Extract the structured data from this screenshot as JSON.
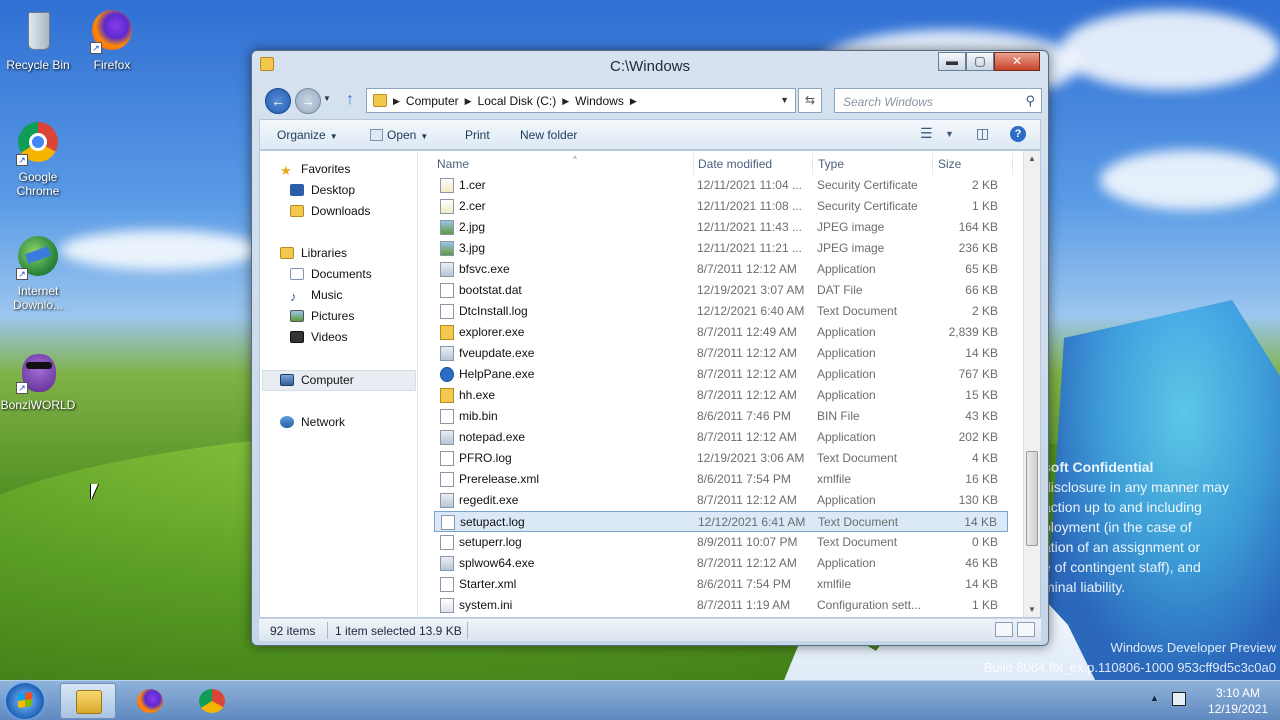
{
  "desktop": {
    "icons": [
      {
        "label": "Recycle Bin",
        "icon": "recycle-bin-icon"
      },
      {
        "label": "Firefox",
        "icon": "firefox-icon"
      },
      {
        "label": "Google Chrome",
        "icon": "chrome-icon"
      },
      {
        "label": "Internet Downlo...",
        "icon": "internet-download-manager-icon"
      },
      {
        "label": "BonziWORLD",
        "icon": "bonziworld-icon"
      }
    ],
    "watermark": {
      "title": "soft Confidential",
      "body": "disclosure in any manner may\naction up to and including\nployment (in the case of\nation of an assignment or\ne of contingent staff), and\nminal liability.",
      "build_line1": "Windows Developer Preview",
      "build_line2": "Build 8064.fbl_ex.p.110806-1000 953cff9d5c3c0a0"
    }
  },
  "window": {
    "title": "C:\\Windows",
    "controls": {
      "minimize": "▬",
      "maximize": "▢",
      "close": "✕"
    },
    "address": {
      "crumbs": [
        "Computer",
        "Local Disk (C:)",
        "Windows"
      ]
    },
    "search": {
      "placeholder": "Search Windows"
    },
    "toolbar": {
      "organize": "Organize",
      "open": "Open",
      "print": "Print",
      "new_folder": "New folder"
    },
    "nav": {
      "favorites": "Favorites",
      "desktop": "Desktop",
      "downloads": "Downloads",
      "libraries": "Libraries",
      "documents": "Documents",
      "music": "Music",
      "pictures": "Pictures",
      "videos": "Videos",
      "computer": "Computer",
      "network": "Network"
    },
    "columns": {
      "name": "Name",
      "date": "Date modified",
      "type": "Type",
      "size": "Size"
    },
    "files": [
      {
        "name": "1.cer",
        "date": "12/11/2021 11:04 ...",
        "type": "Security Certificate",
        "size": "2 KB",
        "icon": "cert"
      },
      {
        "name": "2.cer",
        "date": "12/11/2021 11:08 ...",
        "type": "Security Certificate",
        "size": "1 KB",
        "icon": "cert"
      },
      {
        "name": "2.jpg",
        "date": "12/11/2021 11:43 ...",
        "type": "JPEG image",
        "size": "164 KB",
        "icon": "img"
      },
      {
        "name": "3.jpg",
        "date": "12/11/2021 11:21 ...",
        "type": "JPEG image",
        "size": "236 KB",
        "icon": "img"
      },
      {
        "name": "bfsvc.exe",
        "date": "8/7/2011 12:12 AM",
        "type": "Application",
        "size": "65 KB",
        "icon": "app"
      },
      {
        "name": "bootstat.dat",
        "date": "12/19/2021 3:07 AM",
        "type": "DAT File",
        "size": "66 KB",
        "icon": "file"
      },
      {
        "name": "DtcInstall.log",
        "date": "12/12/2021 6:40 AM",
        "type": "Text Document",
        "size": "2 KB",
        "icon": "file"
      },
      {
        "name": "explorer.exe",
        "date": "8/7/2011 12:49 AM",
        "type": "Application",
        "size": "2,839 KB",
        "icon": "folder"
      },
      {
        "name": "fveupdate.exe",
        "date": "8/7/2011 12:12 AM",
        "type": "Application",
        "size": "14 KB",
        "icon": "app"
      },
      {
        "name": "HelpPane.exe",
        "date": "8/7/2011 12:12 AM",
        "type": "Application",
        "size": "767 KB",
        "icon": "help"
      },
      {
        "name": "hh.exe",
        "date": "8/7/2011 12:12 AM",
        "type": "Application",
        "size": "15 KB",
        "icon": "folder"
      },
      {
        "name": "mib.bin",
        "date": "8/6/2011 7:46 PM",
        "type": "BIN File",
        "size": "43 KB",
        "icon": "file"
      },
      {
        "name": "notepad.exe",
        "date": "8/7/2011 12:12 AM",
        "type": "Application",
        "size": "202 KB",
        "icon": "app"
      },
      {
        "name": "PFRO.log",
        "date": "12/19/2021 3:06 AM",
        "type": "Text Document",
        "size": "4 KB",
        "icon": "file"
      },
      {
        "name": "Prerelease.xml",
        "date": "8/6/2011 7:54 PM",
        "type": "xmlfile",
        "size": "16 KB",
        "icon": "file"
      },
      {
        "name": "regedit.exe",
        "date": "8/7/2011 12:12 AM",
        "type": "Application",
        "size": "130 KB",
        "icon": "app"
      },
      {
        "name": "setupact.log",
        "date": "12/12/2021 6:41 AM",
        "type": "Text Document",
        "size": "14 KB",
        "icon": "file",
        "selected": true
      },
      {
        "name": "setuperr.log",
        "date": "8/9/2011 10:07 PM",
        "type": "Text Document",
        "size": "0 KB",
        "icon": "file"
      },
      {
        "name": "splwow64.exe",
        "date": "8/7/2011 12:12 AM",
        "type": "Application",
        "size": "46 KB",
        "icon": "app"
      },
      {
        "name": "Starter.xml",
        "date": "8/6/2011 7:54 PM",
        "type": "xmlfile",
        "size": "14 KB",
        "icon": "file"
      },
      {
        "name": "system.ini",
        "date": "8/7/2011 1:19 AM",
        "type": "Configuration sett...",
        "size": "1 KB",
        "icon": "cfg"
      }
    ],
    "status": {
      "items": "92 items",
      "selected": "1 item selected",
      "size": "13.9 KB"
    }
  },
  "taskbar": {
    "apps": [
      "file-explorer",
      "firefox",
      "chrome"
    ],
    "time": "3:10 AM",
    "date": "12/19/2021"
  }
}
